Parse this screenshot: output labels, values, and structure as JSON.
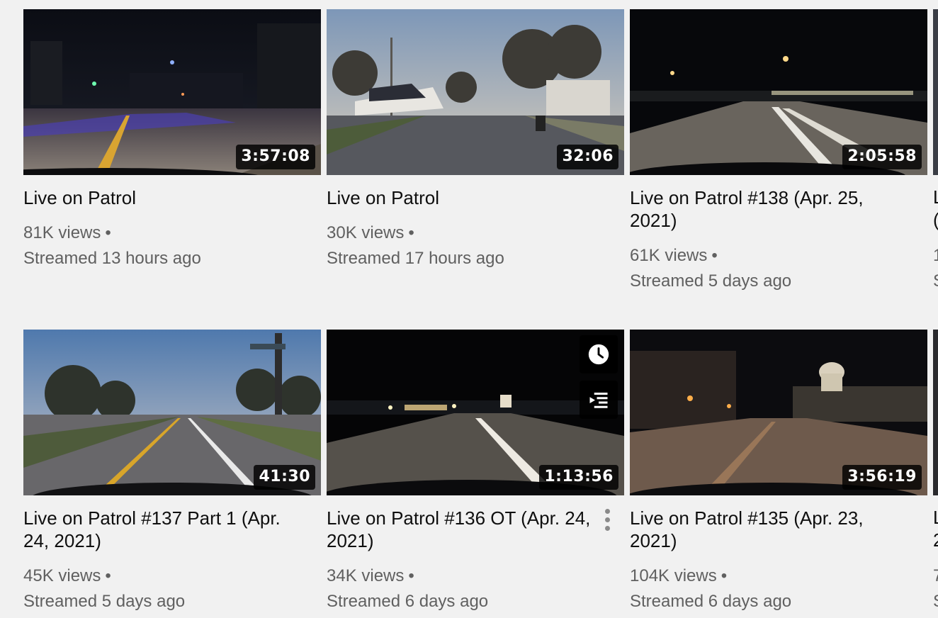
{
  "videos": [
    {
      "title": "Live on Patrol",
      "duration": "3:57:08",
      "views": "81K views",
      "dot": "•",
      "streamed": "Streamed 13 hours ago"
    },
    {
      "title": "Live on Patrol",
      "duration": "32:06",
      "views": "30K views",
      "dot": "•",
      "streamed": "Streamed 17 hours ago"
    },
    {
      "title": "Live on Patrol #138 (Apr. 25, 2021)",
      "duration": "2:05:58",
      "views": "61K views",
      "dot": "•",
      "streamed": "Streamed 5 days ago"
    },
    {
      "title": "Live on Patrol #137 Part 1 (Apr. 24, 2021)",
      "duration": "41:30",
      "views": "45K views",
      "dot": "•",
      "streamed": "Streamed 5 days ago"
    },
    {
      "title": "Live on Patrol #136 OT (Apr. 24, 2021)",
      "duration": "1:13:56",
      "views": "34K views",
      "dot": "•",
      "streamed": "Streamed 6 days ago"
    },
    {
      "title": "Live on Patrol #135 (Apr. 23, 2021)",
      "duration": "3:56:19",
      "views": "104K views",
      "dot": "•",
      "streamed": "Streamed 6 days ago"
    }
  ],
  "partial_column": {
    "row1_lines": [
      "L",
      "(",
      "1",
      "S"
    ],
    "row2_lines": [
      "L",
      "2",
      "7",
      "S"
    ]
  },
  "hover_actions": {
    "watch_later_icon": "clock-icon",
    "add_to_queue_icon": "add-to-queue-icon",
    "menu_icon": "more-vert-icon"
  }
}
